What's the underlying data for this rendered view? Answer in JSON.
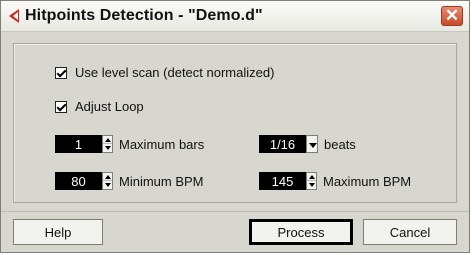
{
  "window": {
    "title": "Hitpoints Detection - \"Demo.d\"",
    "close_glyph": "✕",
    "accent_color": "#c8281e"
  },
  "options": {
    "level_scan": {
      "label": "Use level scan (detect normalized)",
      "checked": true
    },
    "adjust_loop": {
      "label": "Adjust Loop",
      "checked": true
    }
  },
  "fields": {
    "max_bars": {
      "value": "1",
      "label": "Maximum bars"
    },
    "beats": {
      "value": "1/16",
      "label": "beats"
    },
    "min_bpm": {
      "value": "80",
      "label": "Minimum BPM"
    },
    "max_bpm": {
      "value": "145",
      "label": "Maximum BPM"
    }
  },
  "buttons": {
    "help": "Help",
    "process": "Process",
    "cancel": "Cancel"
  }
}
